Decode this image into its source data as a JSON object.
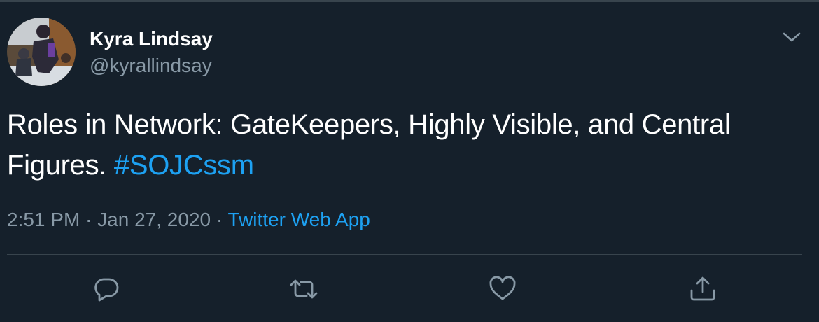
{
  "user": {
    "display_name": "Kyra Lindsay",
    "handle": "@kyrallindsay",
    "avatar_icon": "profile-photo"
  },
  "tweet": {
    "text": "Roles in Network: GateKeepers, Highly Visible, and Central Figures. ",
    "hashtag": "#SOJCssm"
  },
  "meta": {
    "time": "2:51 PM",
    "separator1": " · ",
    "date": "Jan 27, 2020",
    "separator2": " · ",
    "source": "Twitter Web App"
  },
  "actions": [
    {
      "name": "reply",
      "icon": "comment-icon"
    },
    {
      "name": "retweet",
      "icon": "retweet-icon"
    },
    {
      "name": "like",
      "icon": "heart-icon"
    },
    {
      "name": "share",
      "icon": "share-icon"
    }
  ],
  "colors": {
    "background": "#15202b",
    "primary_text": "#ffffff",
    "secondary_text": "#8899a6",
    "accent": "#1da1f2",
    "border": "#38444d"
  }
}
